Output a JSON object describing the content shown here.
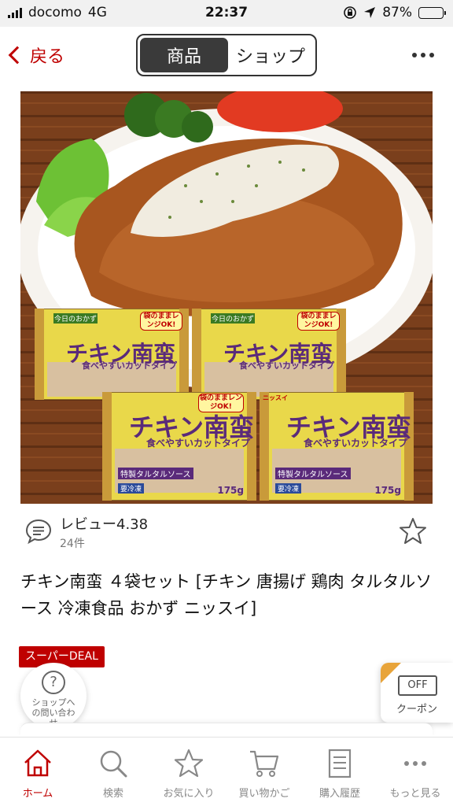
{
  "status_bar": {
    "carrier": "docomo",
    "network": "4G",
    "time": "22:37",
    "battery": "87%"
  },
  "header": {
    "back_label": "戻る",
    "segments": [
      "商品",
      "ショップ"
    ],
    "active_segment": 0
  },
  "product": {
    "image": {
      "package_brand": "ニッスイ",
      "package_tag": "今日のおかず",
      "package_name": "チキン南蛮",
      "package_subtitle": "食べやすいカットタイプ",
      "package_badge": "袋のままレンジOK!",
      "package_sauce": "特製タルタルソース",
      "package_weight": "175g",
      "package_frozen": "要冷凍"
    },
    "review_label": "レビュー4.38",
    "review_count": "24件",
    "rating": 4.38,
    "title": "チキン南蛮 ４袋セット [チキン 唐揚げ 鶏肉 タルタルソース 冷凍食品 おかず ニッスイ]",
    "deal_badge": "スーパーDEAL"
  },
  "floating": {
    "inquiry_label": "ショップへの問い合わせ",
    "inquiry_icon": "?",
    "coupon_state": "OFF",
    "coupon_label": "クーポン"
  },
  "tabs": [
    {
      "label": "ホーム",
      "icon": "home-icon",
      "active": true
    },
    {
      "label": "検索",
      "icon": "search-icon",
      "active": false
    },
    {
      "label": "お気に入り",
      "icon": "star-icon",
      "active": false
    },
    {
      "label": "買い物かご",
      "icon": "cart-icon",
      "active": false
    },
    {
      "label": "購入履歴",
      "icon": "history-icon",
      "active": false
    },
    {
      "label": "もっと見る",
      "icon": "more-icon",
      "active": false
    }
  ],
  "colors": {
    "accent": "#bf0000",
    "coupon_corner": "#e8a43a",
    "package_yellow": "#e9d84a",
    "package_purple": "#5a2a7a"
  }
}
